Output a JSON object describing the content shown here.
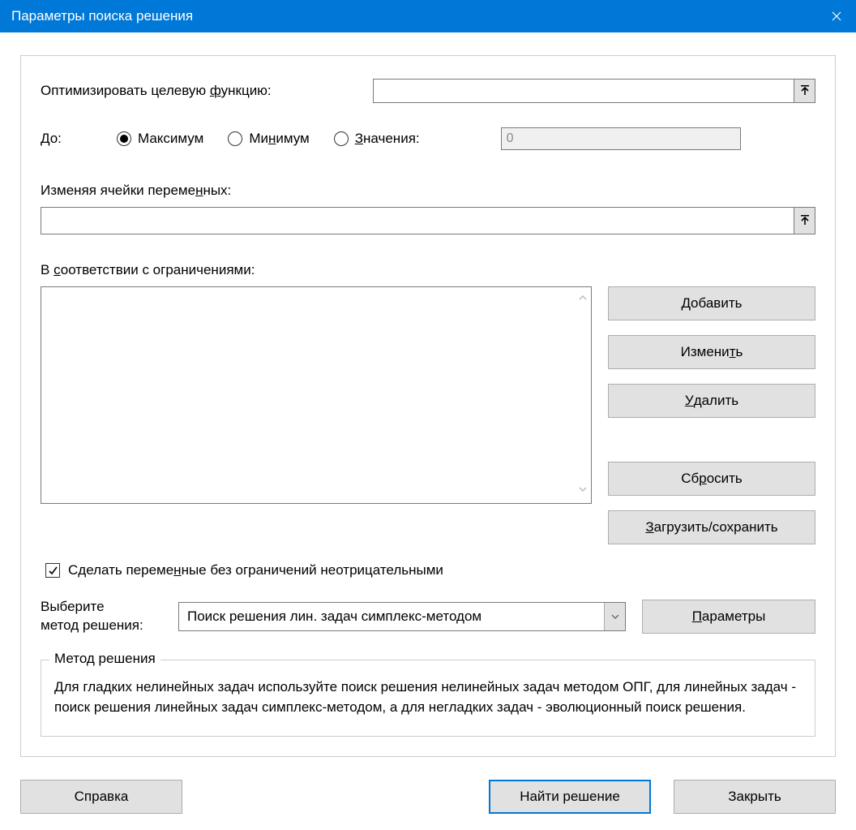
{
  "title": "Параметры поиска решения",
  "objective": {
    "label": "Оптимизировать целевую функцию:",
    "value": ""
  },
  "to": {
    "label": "До:",
    "options": {
      "max": "Максимум",
      "min": "Минимум",
      "value": "Значения:"
    },
    "selected": "max",
    "value_input": "0"
  },
  "variables": {
    "label": "Изменяя ячейки переменных:",
    "value": ""
  },
  "constraints": {
    "label": "В соответствии с ограничениями:",
    "buttons": {
      "add": "Добавить",
      "change": "Изменить",
      "delete": "Удалить",
      "reset": "Сбросить",
      "load_save": "Загрузить/сохранить"
    }
  },
  "nonneg_checkbox": {
    "label": "Сделать переменные без ограничений неотрицательными",
    "checked": true
  },
  "method": {
    "label": "Выберите\nметод решения:",
    "selected": "Поиск решения лин. задач симплекс-методом",
    "options_button": "Параметры"
  },
  "help_group": {
    "legend": "Метод решения",
    "text": "Для гладких нелинейных задач используйте поиск решения нелинейных задач методом ОПГ, для линейных задач - поиск решения линейных задач симплекс-методом, а для негладких задач - эволюционный поиск решения."
  },
  "bottom": {
    "help": "Справка",
    "solve": "Найти решение",
    "close": "Закрыть"
  }
}
